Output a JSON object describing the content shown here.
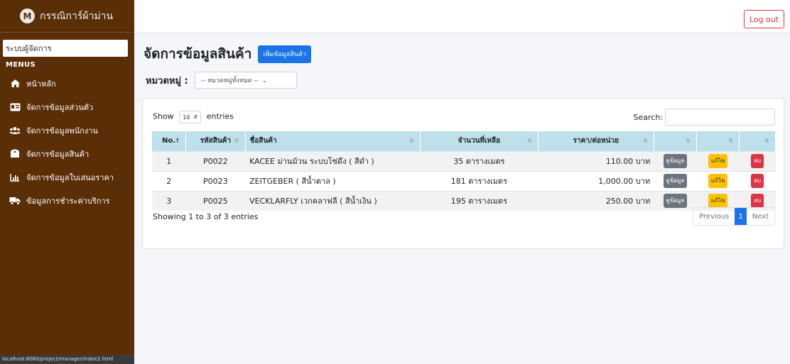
{
  "brand": {
    "logo_letter": "M",
    "name": "กรรณิการ์ผ้าม่าน"
  },
  "topbar": {
    "logout_label": "Log out"
  },
  "sidebar": {
    "role_label": "ระบบผู้จัดการ",
    "menus_label": "MENUS",
    "items": [
      {
        "label": "หน้าหลัก",
        "icon": "home-icon"
      },
      {
        "label": "จัดการข้อมูลส่วนตัว",
        "icon": "id-card-icon"
      },
      {
        "label": "จัดการข้อมูลพนักงาน",
        "icon": "users-icon"
      },
      {
        "label": "จัดการข้อมูลสินค้า",
        "icon": "toilet-paper-icon"
      },
      {
        "label": "จัดการข้อมูลใบเสนอราคา",
        "icon": "bar-chart-icon"
      },
      {
        "label": "ข้อมูลการชำระค่าบริการ",
        "icon": "truck-icon"
      }
    ]
  },
  "status_url": "localhost:8080/project/manager/index2.html",
  "page": {
    "title": "จัดการข้อมูลสินค้า",
    "add_button": "เพิ่มข้อมูลสินค้า",
    "filter_label": "หมวดหมู่ :",
    "filter_value": "-- หมวดหมู่ทั้งหมด --"
  },
  "datatable": {
    "show_label": "Show",
    "length_value": "10",
    "entries_label": "entries",
    "search_label": "Search:",
    "columns": [
      "No.",
      "รหัสสินค้า",
      "ชื่อสินค้า",
      "จำนวนที่เหลือ",
      "ราคา/ต่อหน่วย",
      "",
      "",
      ""
    ],
    "rows": [
      {
        "no": "1",
        "code": "P0022",
        "name": "KACEE ม่านม้วน ระบบโซ่ดึง ( สีดำ )",
        "remain": "35 ตารางเมตร",
        "price": "110.00 บาท"
      },
      {
        "no": "2",
        "code": "P0023",
        "name": "ZEITGEBER ( สีน้ำตาล )",
        "remain": "181 ตารางเมตร",
        "price": "1,000.00 บาท"
      },
      {
        "no": "3",
        "code": "P0025",
        "name": "VECKLARFLY เวกคลาฟลี ( สีน้ำเงิน )",
        "remain": "195 ตารางเมตร",
        "price": "250.00 บาท"
      }
    ],
    "view_label": "ดูข้อมูล",
    "edit_label": "แก้ไข",
    "delete_label": "ลบ",
    "info": "Showing 1 to 3 of 3 entries",
    "prev_label": "Previous",
    "current_page": "1",
    "next_label": "Next"
  },
  "colors": {
    "sidebar_bg": "#5a2e07",
    "primary": "#1a73e8",
    "header_bg": "#bde0eb",
    "danger": "#dc3545",
    "warning": "#ffc107",
    "secondary": "#6c757d"
  }
}
